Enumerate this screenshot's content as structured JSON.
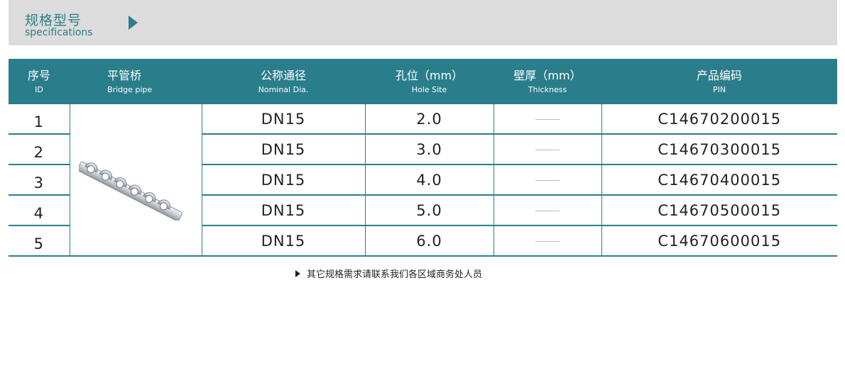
{
  "banner": {
    "title_cn": "规格型号",
    "title_en": "specifications"
  },
  "table": {
    "headers": [
      {
        "cn": "序号",
        "en": "ID"
      },
      {
        "cn": "平管桥",
        "en": "Bridge pipe"
      },
      {
        "cn": "公称通径",
        "en": "Nominal Dia."
      },
      {
        "cn": "孔位（mm）",
        "en": "Hole Site"
      },
      {
        "cn": "壁厚（mm）",
        "en": "Thickness"
      },
      {
        "cn": "产品编码",
        "en": "PIN"
      }
    ],
    "rows": [
      {
        "id": "1",
        "nominal": "DN15",
        "hole": "2.0",
        "thickness": "——",
        "pin": "C14670200015"
      },
      {
        "id": "2",
        "nominal": "DN15",
        "hole": "3.0",
        "thickness": "——",
        "pin": "C14670300015"
      },
      {
        "id": "3",
        "nominal": "DN15",
        "hole": "4.0",
        "thickness": "——",
        "pin": "C14670400015"
      },
      {
        "id": "4",
        "nominal": "DN15",
        "hole": "5.0",
        "thickness": "——",
        "pin": "C14670500015"
      },
      {
        "id": "5",
        "nominal": "DN15",
        "hole": "6.0",
        "thickness": "——",
        "pin": "C14670600015"
      }
    ]
  },
  "note": "其它规格需求请联系我们各区域商务处人员",
  "colors": {
    "accent": "#2a7e8b",
    "banner_bg": "#dcdcdc"
  }
}
